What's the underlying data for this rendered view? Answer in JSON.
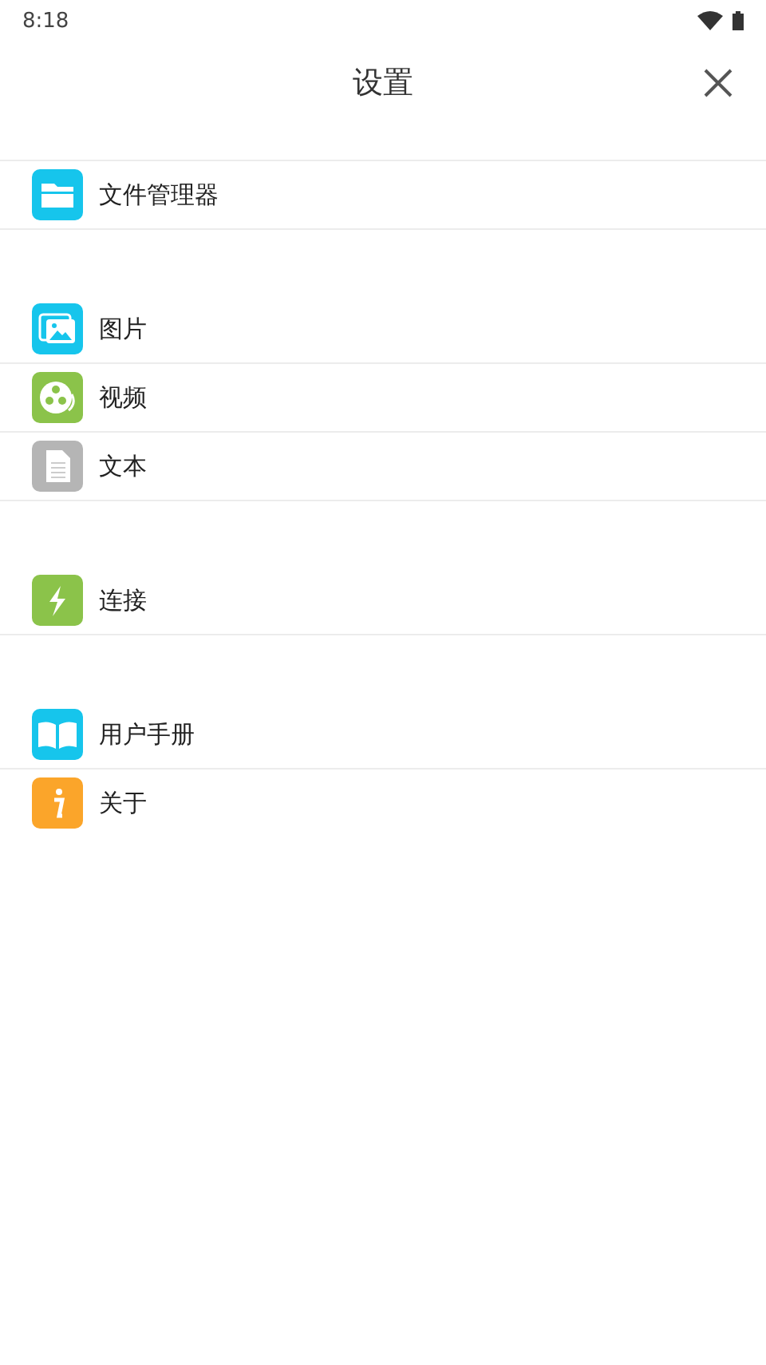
{
  "status_bar": {
    "time": "8:18"
  },
  "header": {
    "title": "设置"
  },
  "groups": [
    {
      "items": [
        {
          "label": "文件管理器",
          "kind": "folder",
          "color": "#16c5ec"
        }
      ]
    },
    {
      "items": [
        {
          "label": "图片",
          "kind": "image",
          "color": "#16c5ec"
        },
        {
          "label": "视频",
          "kind": "video",
          "color": "#8bc34a"
        },
        {
          "label": "文本",
          "kind": "document",
          "color": "#b5b5b5"
        }
      ]
    },
    {
      "items": [
        {
          "label": "连接",
          "kind": "bolt",
          "color": "#8bc34a"
        }
      ]
    },
    {
      "items": [
        {
          "label": "用户手册",
          "kind": "book",
          "color": "#16c5ec"
        },
        {
          "label": "关于",
          "kind": "info",
          "color": "#fba52a"
        }
      ]
    }
  ]
}
